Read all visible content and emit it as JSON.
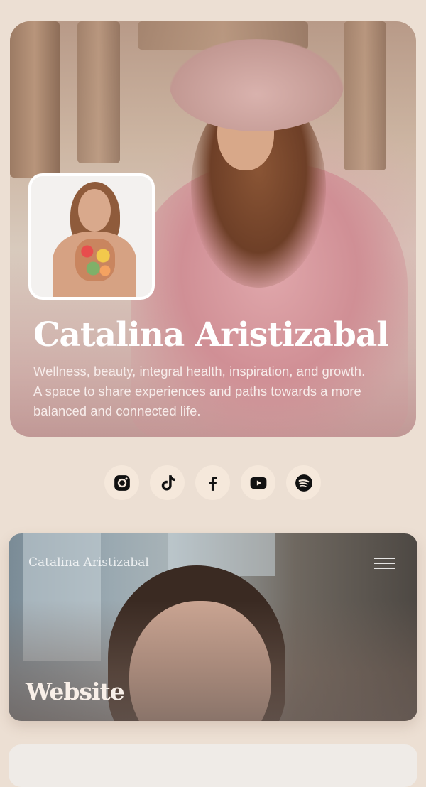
{
  "profile": {
    "name": "Catalina Aristizabal",
    "bio": "Wellness, beauty, integral health, inspiration, and growth. A space to share experiences and paths towards a more balanced and connected life."
  },
  "socials": [
    {
      "icon": "instagram-icon"
    },
    {
      "icon": "tiktok-icon"
    },
    {
      "icon": "facebook-icon"
    },
    {
      "icon": "youtube-icon"
    },
    {
      "icon": "spotify-icon"
    }
  ],
  "website_card": {
    "site_logo": "Catalina Aristizabal",
    "title": "Website"
  },
  "colors": {
    "background": "#ecdfd3",
    "social_bg": "#f5e8db",
    "icon": "#111111",
    "text_light": "#ffffff"
  }
}
